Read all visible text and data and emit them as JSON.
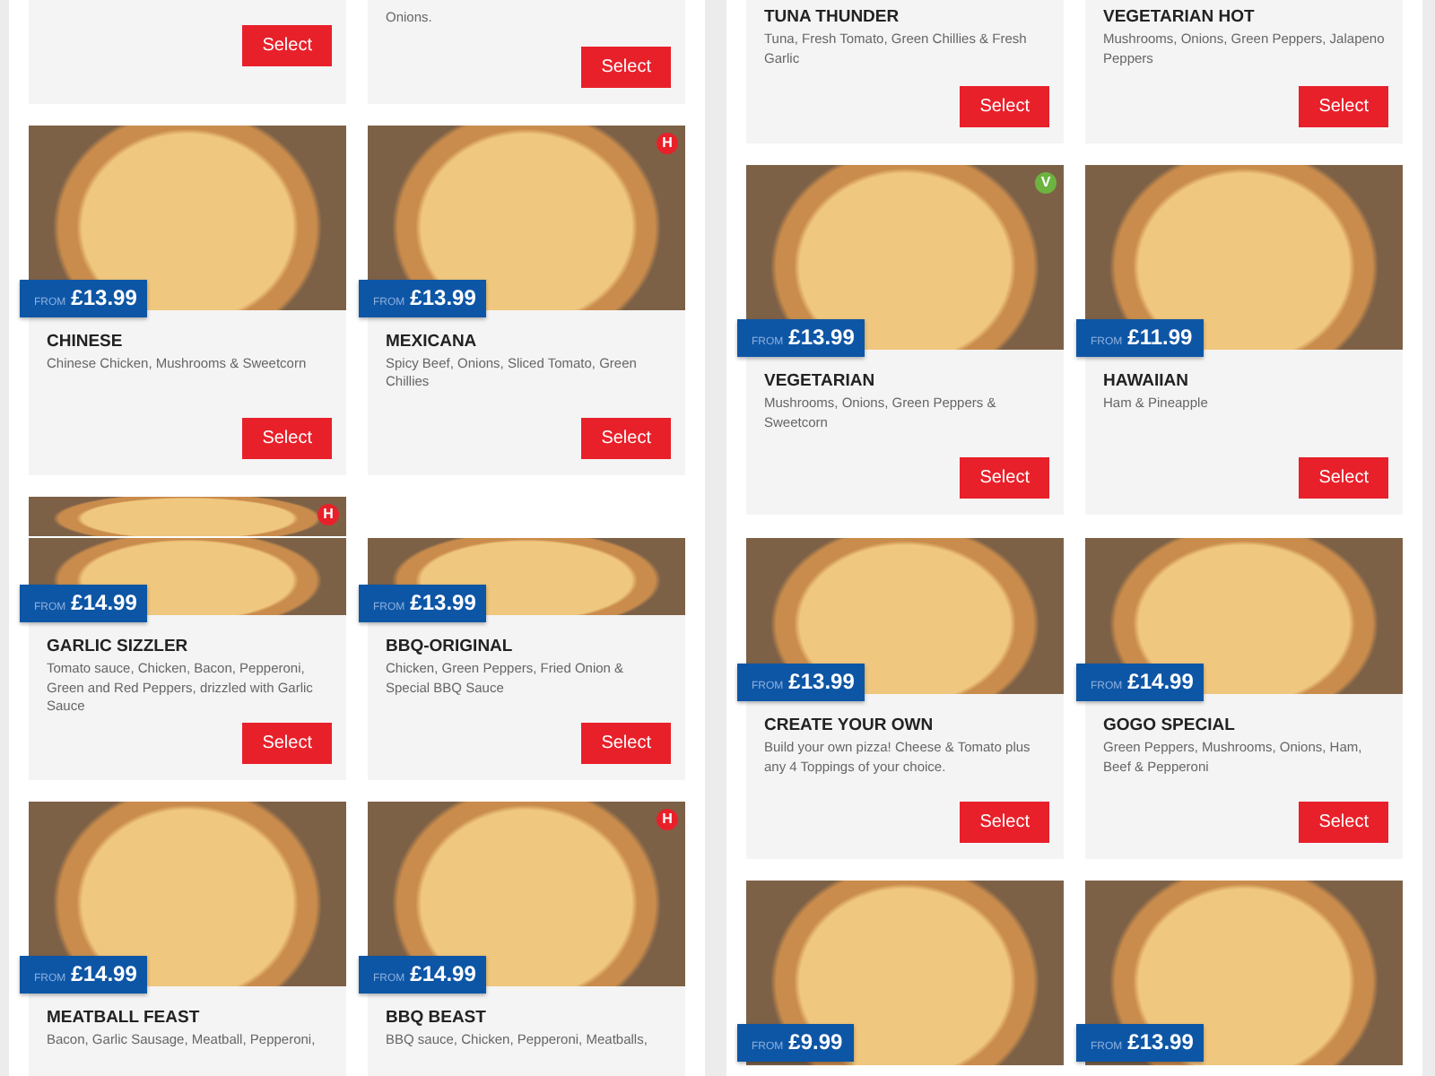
{
  "panels": [
    {
      "rows": [
        {
          "cards": [
            {
              "kind": "tail",
              "button": "Select"
            },
            {
              "kind": "tail",
              "description": "Onions.",
              "button": "Select"
            }
          ]
        },
        {
          "cards": [
            {
              "kind": "full",
              "price_prefix": "FROM",
              "price": "£13.99",
              "name": "CHINESE",
              "description": "Chinese Chicken, Mushrooms & Sweetcorn",
              "button": "Select"
            },
            {
              "kind": "full",
              "badge": {
                "text": "H",
                "color": "#e8202a"
              },
              "price_prefix": "FROM",
              "price": "£13.99",
              "name": "MEXICANA",
              "description": "Spicy Beef, Onions, Sliced Tomato, Green Chillies",
              "button": "Select"
            }
          ]
        },
        {
          "cards": [
            {
              "kind": "strip",
              "badge": {
                "text": "H",
                "color": "#e8202a"
              }
            }
          ]
        }
      ]
    },
    {
      "rows": [
        {
          "cards": [
            {
              "kind": "tail",
              "name": "TUNA THUNDER",
              "description": "Tuna, Fresh Tomato, Green Chillies & Fresh Garlic",
              "button": "Select"
            },
            {
              "kind": "tail",
              "name": "VEGETARIAN HOT",
              "description": "Mushrooms, Onions, Green Peppers, Jalapeno Peppers",
              "button": "Select"
            }
          ]
        },
        {
          "cards": [
            {
              "kind": "full",
              "badge": {
                "text": "V",
                "color": "#6cb33f"
              },
              "price_prefix": "FROM",
              "price": "£13.99",
              "name": "VEGETARIAN",
              "description": "Mushrooms, Onions, Green Peppers & Sweetcorn",
              "button": "Select"
            },
            {
              "kind": "full",
              "price_prefix": "FROM",
              "price": "£11.99",
              "name": "HAWAIIAN",
              "description": "Ham & Pineapple",
              "button": "Select"
            }
          ]
        }
      ]
    },
    {
      "rows": [
        {
          "cards": [
            {
              "kind": "sliver",
              "price_prefix": "FROM",
              "price": "£14.99",
              "name": "GARLIC SIZZLER",
              "description": "Tomato sauce, Chicken, Bacon, Pepperoni, Green and Red Peppers, drizzled with Garlic Sauce",
              "button": "Select"
            },
            {
              "kind": "sliver",
              "price_prefix": "FROM",
              "price": "£13.99",
              "name": "BBQ-ORIGINAL",
              "description": "Chicken, Green Peppers, Fried Onion & Special BBQ Sauce",
              "button": "Select"
            }
          ]
        },
        {
          "cards": [
            {
              "kind": "full",
              "price_prefix": "FROM",
              "price": "£14.99",
              "name": "MEATBALL FEAST",
              "description": "Bacon, Garlic Sausage, Meatball, Pepperoni,"
            },
            {
              "kind": "full",
              "badge": {
                "text": "H",
                "color": "#e8202a"
              },
              "price_prefix": "FROM",
              "price": "£14.99",
              "name": "BBQ BEAST",
              "description": "BBQ sauce, Chicken, Pepperoni, Meatballs,"
            }
          ]
        }
      ]
    },
    {
      "rows": [
        {
          "cards": [
            {
              "kind": "partial",
              "price_prefix": "FROM",
              "price": "£13.99",
              "name": "CREATE YOUR OWN",
              "description": "Build your own pizza! Cheese & Tomato plus any 4 Toppings of your choice.",
              "button": "Select"
            },
            {
              "kind": "partial",
              "price_prefix": "FROM",
              "price": "£14.99",
              "name": "GOGO SPECIAL",
              "description": "Green Peppers, Mushrooms, Onions, Ham, Beef & Pepperoni",
              "button": "Select"
            }
          ]
        },
        {
          "cards": [
            {
              "kind": "full",
              "price_prefix": "FROM",
              "price": "£9.99"
            },
            {
              "kind": "full",
              "price_prefix": "FROM",
              "price": "£13.99"
            }
          ]
        }
      ]
    }
  ]
}
